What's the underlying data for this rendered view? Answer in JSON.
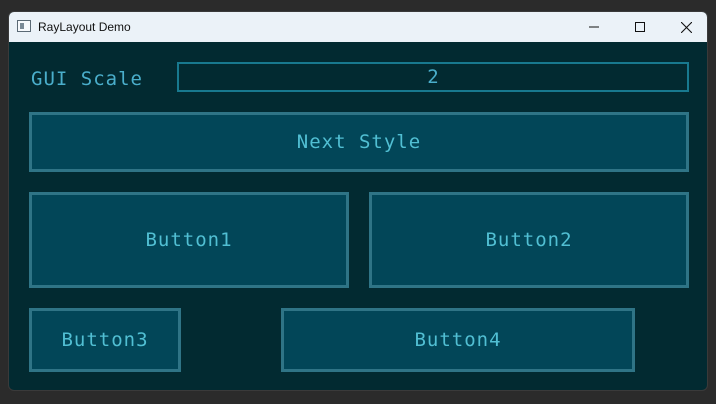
{
  "window": {
    "title": "RayLayout Demo",
    "controls": {
      "minimize": "minimize-icon",
      "maximize": "maximize-icon",
      "close": "close-icon"
    }
  },
  "gui_scale": {
    "label": "GUI Scale",
    "value": "2"
  },
  "buttons": {
    "next_style": "Next Style",
    "button1": "Button1",
    "button2": "Button2",
    "button3": "Button3",
    "button4": "Button4"
  },
  "colors": {
    "background": "#022a31",
    "button_fill": "#024658",
    "button_border": "#2f7486",
    "text": "#51bfd3",
    "titlebar": "#ebf2f8"
  }
}
